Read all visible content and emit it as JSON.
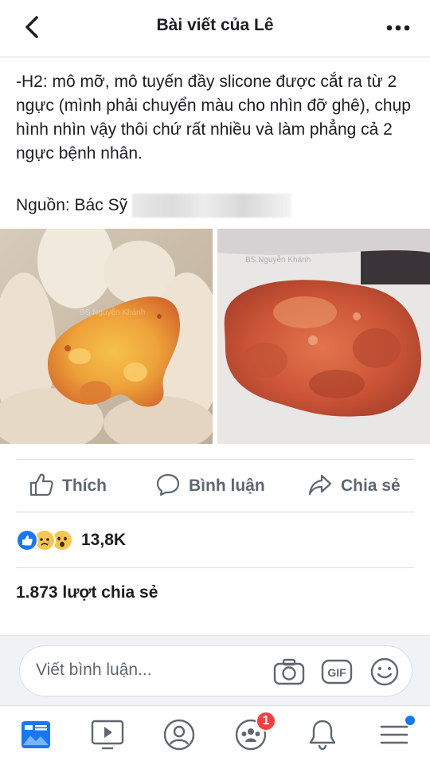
{
  "header": {
    "title": "Bài viết của Lê",
    "back_icon": "chevron-left-icon",
    "more_icon": "more-dots-icon"
  },
  "post": {
    "text": "-H2: mô mỡ, mô tuyến đầy slicone được cắt ra  từ 2 ngực (mình phải chuyển màu cho nhìn đỡ ghê), chụp hình nhìn vậy thôi chứ rất nhiều và làm phẳng cả 2 ngực bệnh nhân.",
    "source_label": "Nguồn: Bác Sỹ",
    "photo_left_watermark": "BS Nguyễn Khánh",
    "photo_right_watermark": "BS.Nguyễn Khánh"
  },
  "actions": {
    "like_label": "Thích",
    "comment_label": "Bình luận",
    "share_label": "Chia sẻ"
  },
  "reactions": {
    "count": "13,8K",
    "types": [
      "like",
      "sad",
      "wow"
    ]
  },
  "shares": {
    "text": "1.873 lượt chia sẻ"
  },
  "composer": {
    "placeholder": "Viết bình luận...",
    "gif_label": "GIF"
  },
  "nav": {
    "groups_badge": "1",
    "items": [
      "news-feed",
      "watch",
      "profile",
      "groups",
      "notifications",
      "menu"
    ]
  },
  "colors": {
    "accent": "#1877f2",
    "text": "#1c1e21",
    "secondary_text": "#606770",
    "badge": "#fa3e3e"
  }
}
